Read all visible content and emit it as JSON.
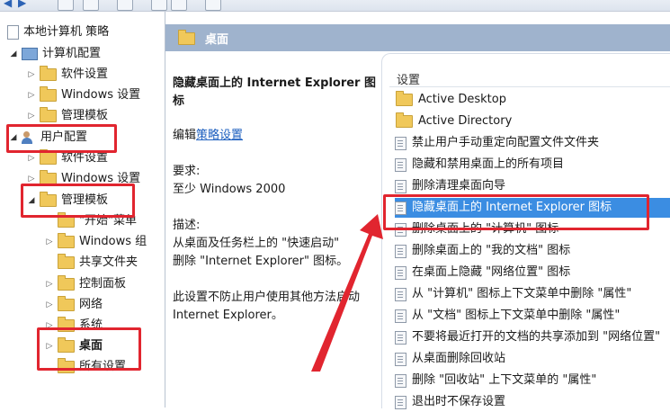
{
  "tree": {
    "items": [
      {
        "label": "本地计算机 策略"
      },
      {
        "label": "计算机配置"
      },
      {
        "label": "软件设置"
      },
      {
        "label": "Windows 设置"
      },
      {
        "label": "管理模板"
      },
      {
        "label": "用户配置"
      },
      {
        "label": "软件设置"
      },
      {
        "label": "Windows 设置"
      },
      {
        "label": "管理模板"
      },
      {
        "label": "\"开始\"菜单"
      },
      {
        "label": "Windows 组"
      },
      {
        "label": "共享文件夹"
      },
      {
        "label": "控制面板"
      },
      {
        "label": "网络"
      },
      {
        "label": "系统"
      },
      {
        "label": "桌面"
      },
      {
        "label": "所有设置"
      }
    ]
  },
  "main": {
    "header_title": "桌面",
    "description": {
      "title": "隐藏桌面上的 Internet Explorer 图标",
      "edit_prefix": "编辑",
      "edit_link": "策略设置",
      "requirements_label": "要求:",
      "requirements_value": "至少 Windows 2000",
      "desc_label": "描述:",
      "desc_line1": "从桌面及任务栏上的 \"快速启动\"",
      "desc_line2": "删除 \"Internet Explorer\" 图标。",
      "note_line1": "此设置不防止用户使用其他方法启动",
      "note_line2": "Internet Explorer。"
    }
  },
  "settings": {
    "header": "设置",
    "rows": [
      {
        "label": "Active Desktop",
        "kind": "folder"
      },
      {
        "label": "Active Directory",
        "kind": "folder"
      },
      {
        "label": "禁止用户手动重定向配置文件文件夹",
        "kind": "policy"
      },
      {
        "label": "隐藏和禁用桌面上的所有项目",
        "kind": "policy"
      },
      {
        "label": "删除清理桌面向导",
        "kind": "policy"
      },
      {
        "label": "隐藏桌面上的 Internet Explorer 图标",
        "kind": "policy"
      },
      {
        "label": "删除桌面上的 \"计算机\" 图标",
        "kind": "policy"
      },
      {
        "label": "删除桌面上的 \"我的文档\" 图标",
        "kind": "policy"
      },
      {
        "label": "在桌面上隐藏 \"网络位置\" 图标",
        "kind": "policy"
      },
      {
        "label": "从 \"计算机\" 图标上下文菜单中删除 \"属性\"",
        "kind": "policy"
      },
      {
        "label": "从 \"文档\" 图标上下文菜单中删除 \"属性\"",
        "kind": "policy"
      },
      {
        "label": "不要将最近打开的文档的共享添加到 \"网络位置\"",
        "kind": "policy"
      },
      {
        "label": "从桌面删除回收站",
        "kind": "policy"
      },
      {
        "label": "删除 \"回收站\" 上下文菜单的 \"属性\"",
        "kind": "policy"
      },
      {
        "label": "退出时不保存设置",
        "kind": "policy"
      }
    ]
  },
  "colors": {
    "highlight_red": "#e1252f",
    "selection_blue": "#3b8de2",
    "header_blue": "#9fb3cd"
  }
}
